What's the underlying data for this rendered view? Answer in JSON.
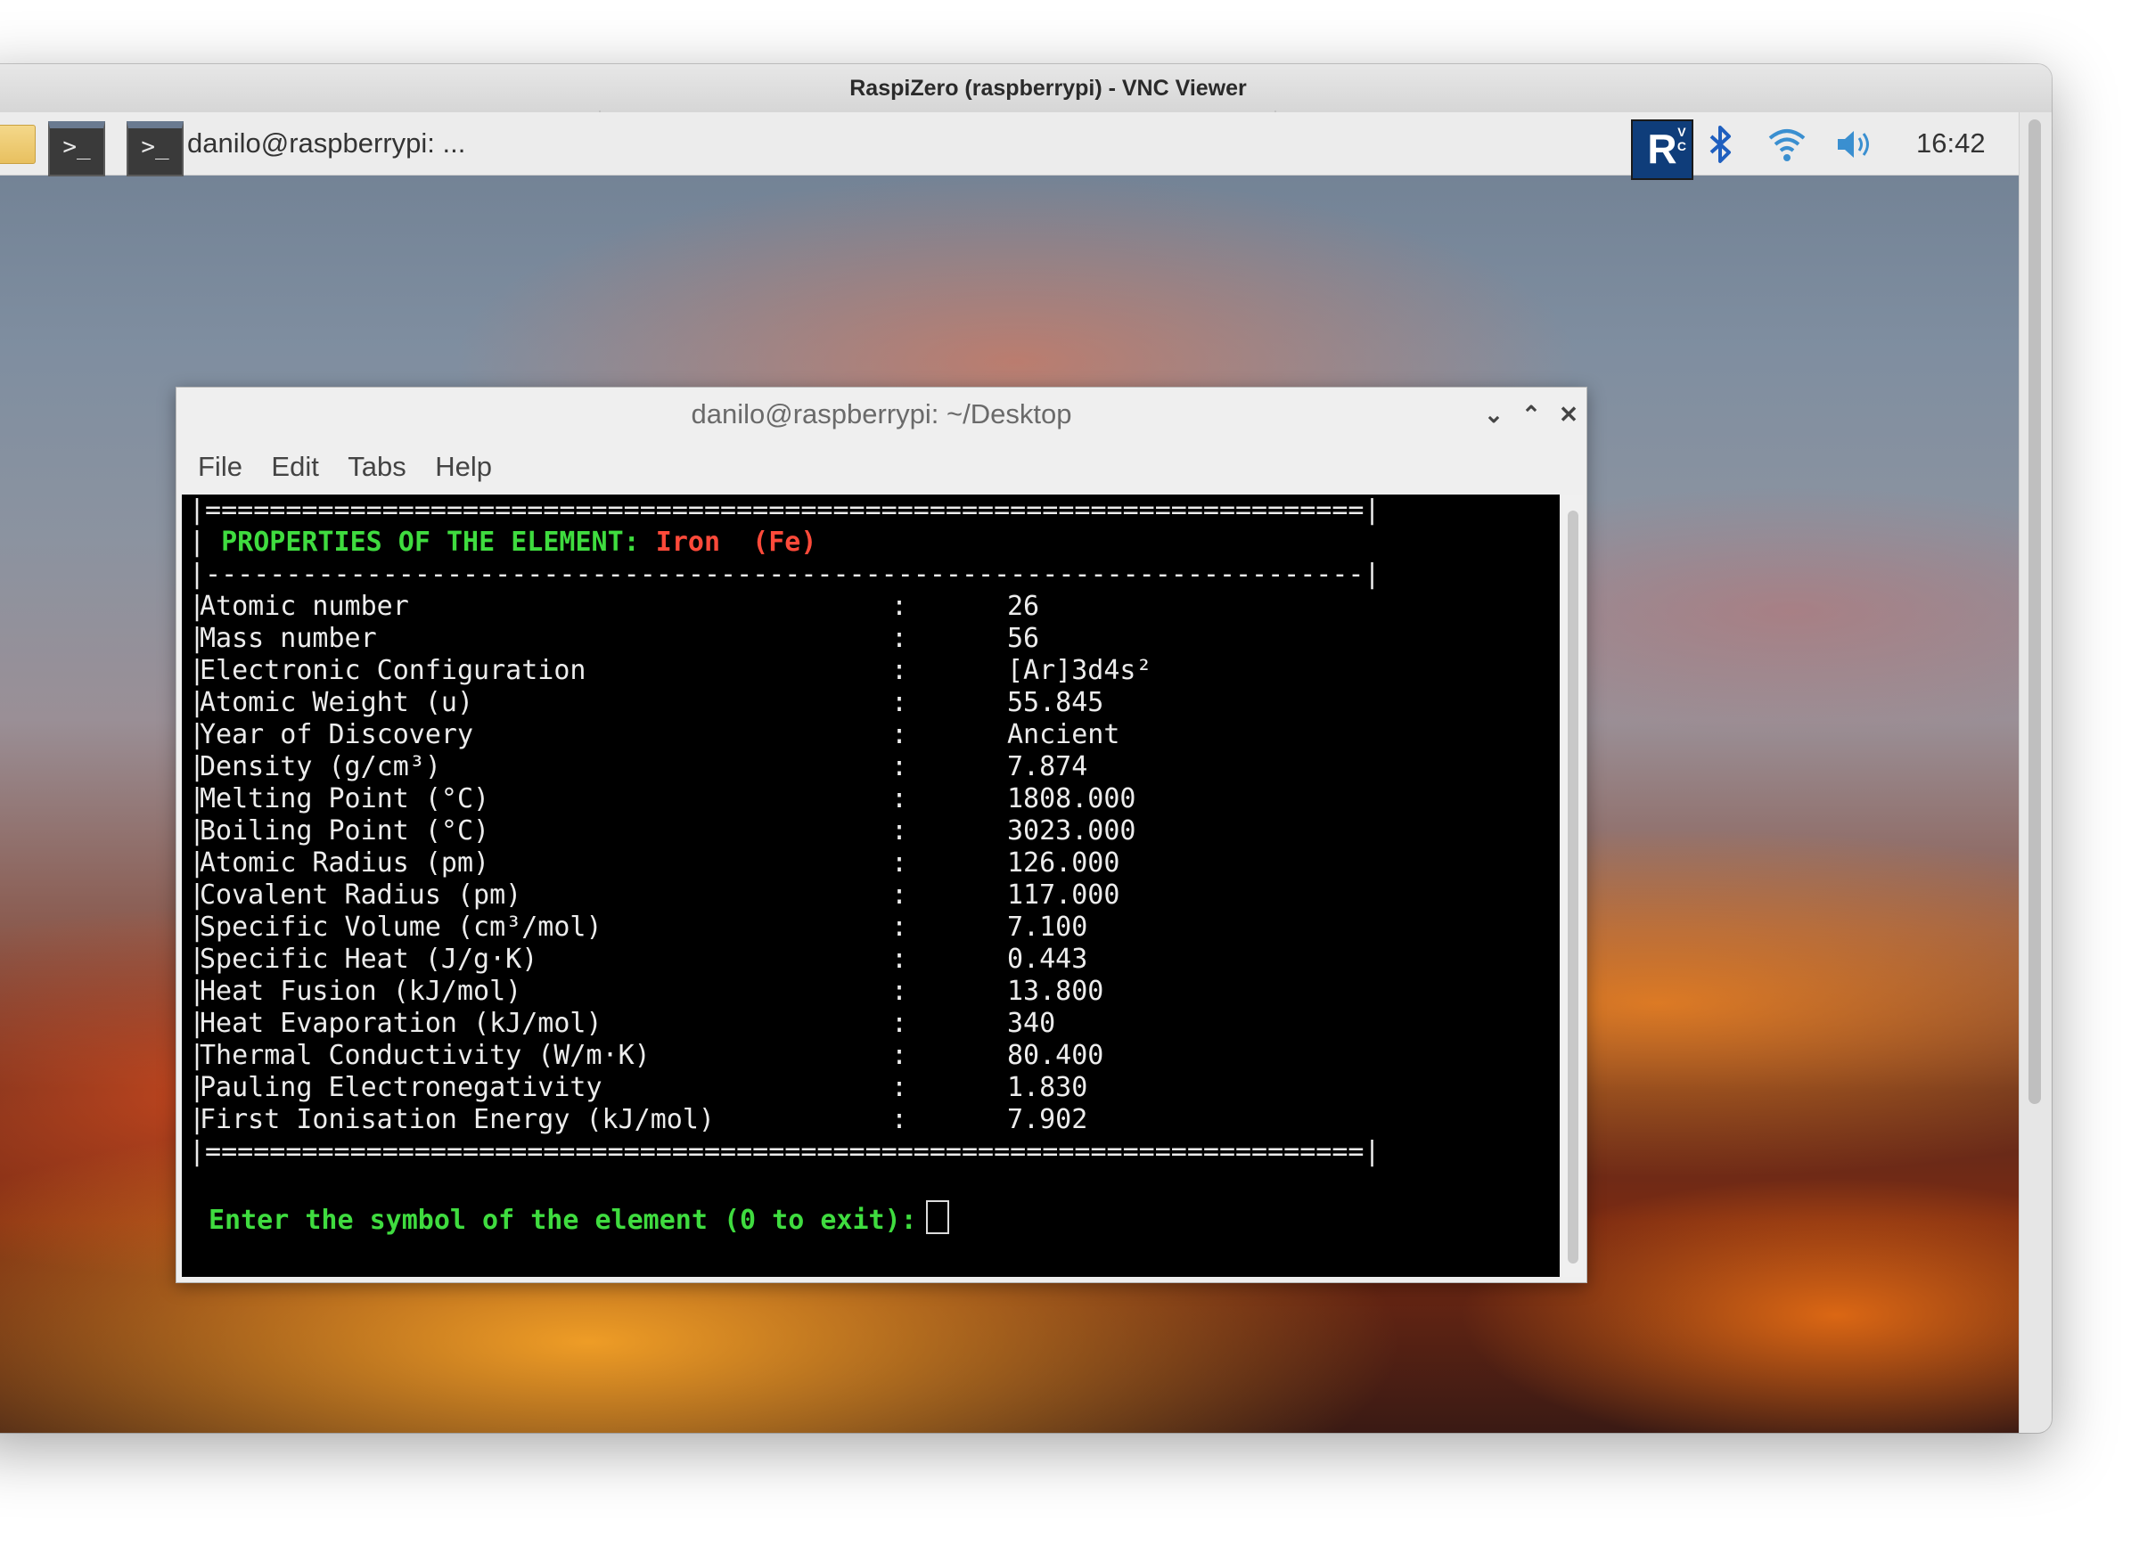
{
  "vnc": {
    "title": "RaspiZero (raspberrypi) - VNC Viewer"
  },
  "taskbar": {
    "task_label": "danilo@raspberrypi: ...",
    "vnc_logo": "R",
    "vnc_logo_small": "V\nC",
    "time": "16:42",
    "icons": [
      "folder-icon",
      "terminal-icon",
      "vnc-server-icon",
      "bluetooth-icon",
      "wifi-icon",
      "volume-icon"
    ]
  },
  "terminal": {
    "title": "danilo@raspberrypi: ~/Desktop",
    "menu": [
      "File",
      "Edit",
      "Tabs",
      "Help"
    ],
    "border_top": "|========================================================================|",
    "separator": "|------------------------------------------------------------------------|",
    "border_bottom": "|========================================================================|",
    "header_prefix": "PROPERTIES OF THE ELEMENT:",
    "element_name": "Iron",
    "element_symbol": "(Fe)",
    "properties": [
      {
        "label": "Atomic number",
        "value": "26"
      },
      {
        "label": "Mass number",
        "value": "56"
      },
      {
        "label": "Electronic Configuration",
        "value": "[Ar]3d4s²"
      },
      {
        "label": "Atomic Weight (u)",
        "value": "55.845"
      },
      {
        "label": "Year of Discovery",
        "value": "Ancient"
      },
      {
        "label": "Density (g/cm³)",
        "value": "7.874"
      },
      {
        "label": "Melting Point (°C)",
        "value": "1808.000"
      },
      {
        "label": "Boiling Point (°C)",
        "value": "3023.000"
      },
      {
        "label": "Atomic Radius (pm)",
        "value": "126.000"
      },
      {
        "label": "Covalent Radius (pm)",
        "value": "117.000"
      },
      {
        "label": "Specific Volume (cm³/mol)",
        "value": "7.100"
      },
      {
        "label": "Specific Heat (J/g·K)",
        "value": "0.443"
      },
      {
        "label": "Heat Fusion (kJ/mol)",
        "value": "13.800"
      },
      {
        "label": "Heat Evaporation (kJ/mol)",
        "value": "340"
      },
      {
        "label": "Thermal Conductivity (W/m·K)",
        "value": "80.400"
      },
      {
        "label": "Pauling Electronegativity",
        "value": "1.830"
      },
      {
        "label": "First Ionisation Energy (kJ/mol)",
        "value": "7.902"
      }
    ],
    "prompt": "Enter the symbol of the element (0 to exit):"
  }
}
